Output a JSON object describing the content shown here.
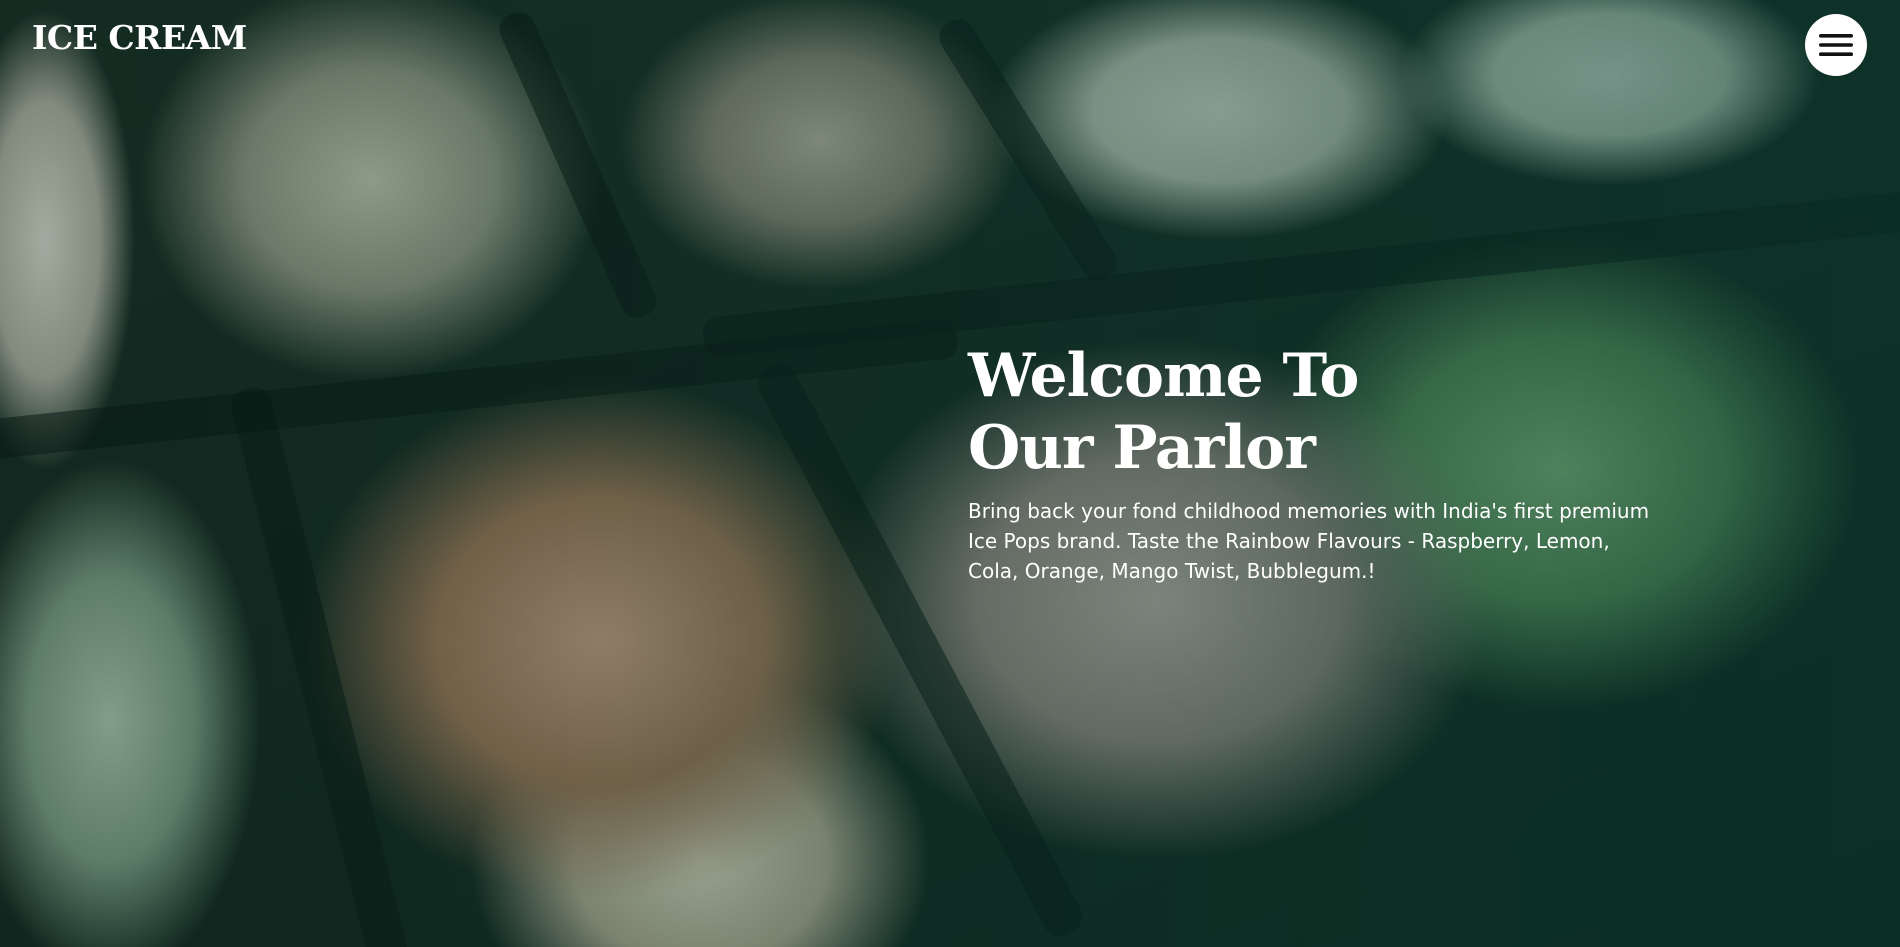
{
  "header": {
    "brand": "ICE CREAM",
    "menu_icon": "hamburger-menu-icon"
  },
  "hero": {
    "title_line1": "Welcome To",
    "title_line2": "Our Parlor",
    "description": "Bring back your fond childhood memories with India's first premium Ice Pops brand. Taste the Rainbow Flavours - Raspberry, Lemon, Cola, Orange, Mango Twist, Bubblegum.!"
  },
  "colors": {
    "overlay": "#0a3c30",
    "text": "#ffffff",
    "menu_button": "#ffffff"
  }
}
